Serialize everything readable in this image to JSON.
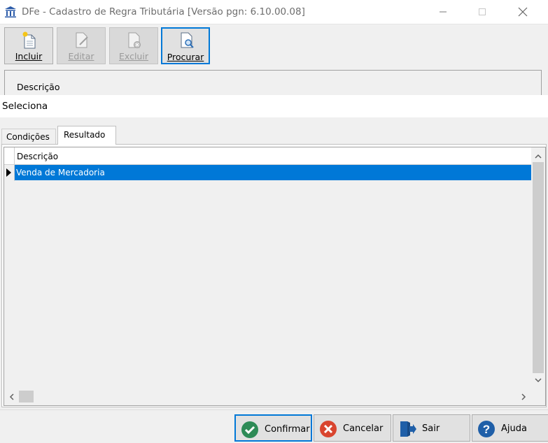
{
  "parent_window": {
    "title": "DFe - Cadastro de Regra Tributária [Versão pgn: 6.10.00.08]",
    "toolbar": [
      {
        "label": "Incluir",
        "icon": "new-document-icon",
        "enabled": true
      },
      {
        "label": "Editar",
        "icon": "edit-document-icon",
        "enabled": false
      },
      {
        "label": "Excluir",
        "icon": "delete-document-icon",
        "enabled": false
      },
      {
        "label": "Procurar",
        "icon": "search-document-icon",
        "enabled": true
      }
    ],
    "panel_label": "Descrição"
  },
  "dialog": {
    "title": "Seleciona",
    "tabs": [
      {
        "label": "Condições",
        "active": false
      },
      {
        "label": "Resultado",
        "active": true
      }
    ],
    "grid": {
      "columns": [
        "Descrição"
      ],
      "rows": [
        {
          "descricao": "Venda de Mercadoria",
          "selected": true
        }
      ]
    },
    "buttons": {
      "confirmar": "Confirmar",
      "cancelar": "Cancelar",
      "sair": "Sair",
      "ajuda": "Ajuda"
    }
  },
  "colors": {
    "selection": "#0078d7",
    "confirm_green": "#2e8b57",
    "cancel_red": "#d9452f",
    "help_blue": "#1f5fa8"
  }
}
